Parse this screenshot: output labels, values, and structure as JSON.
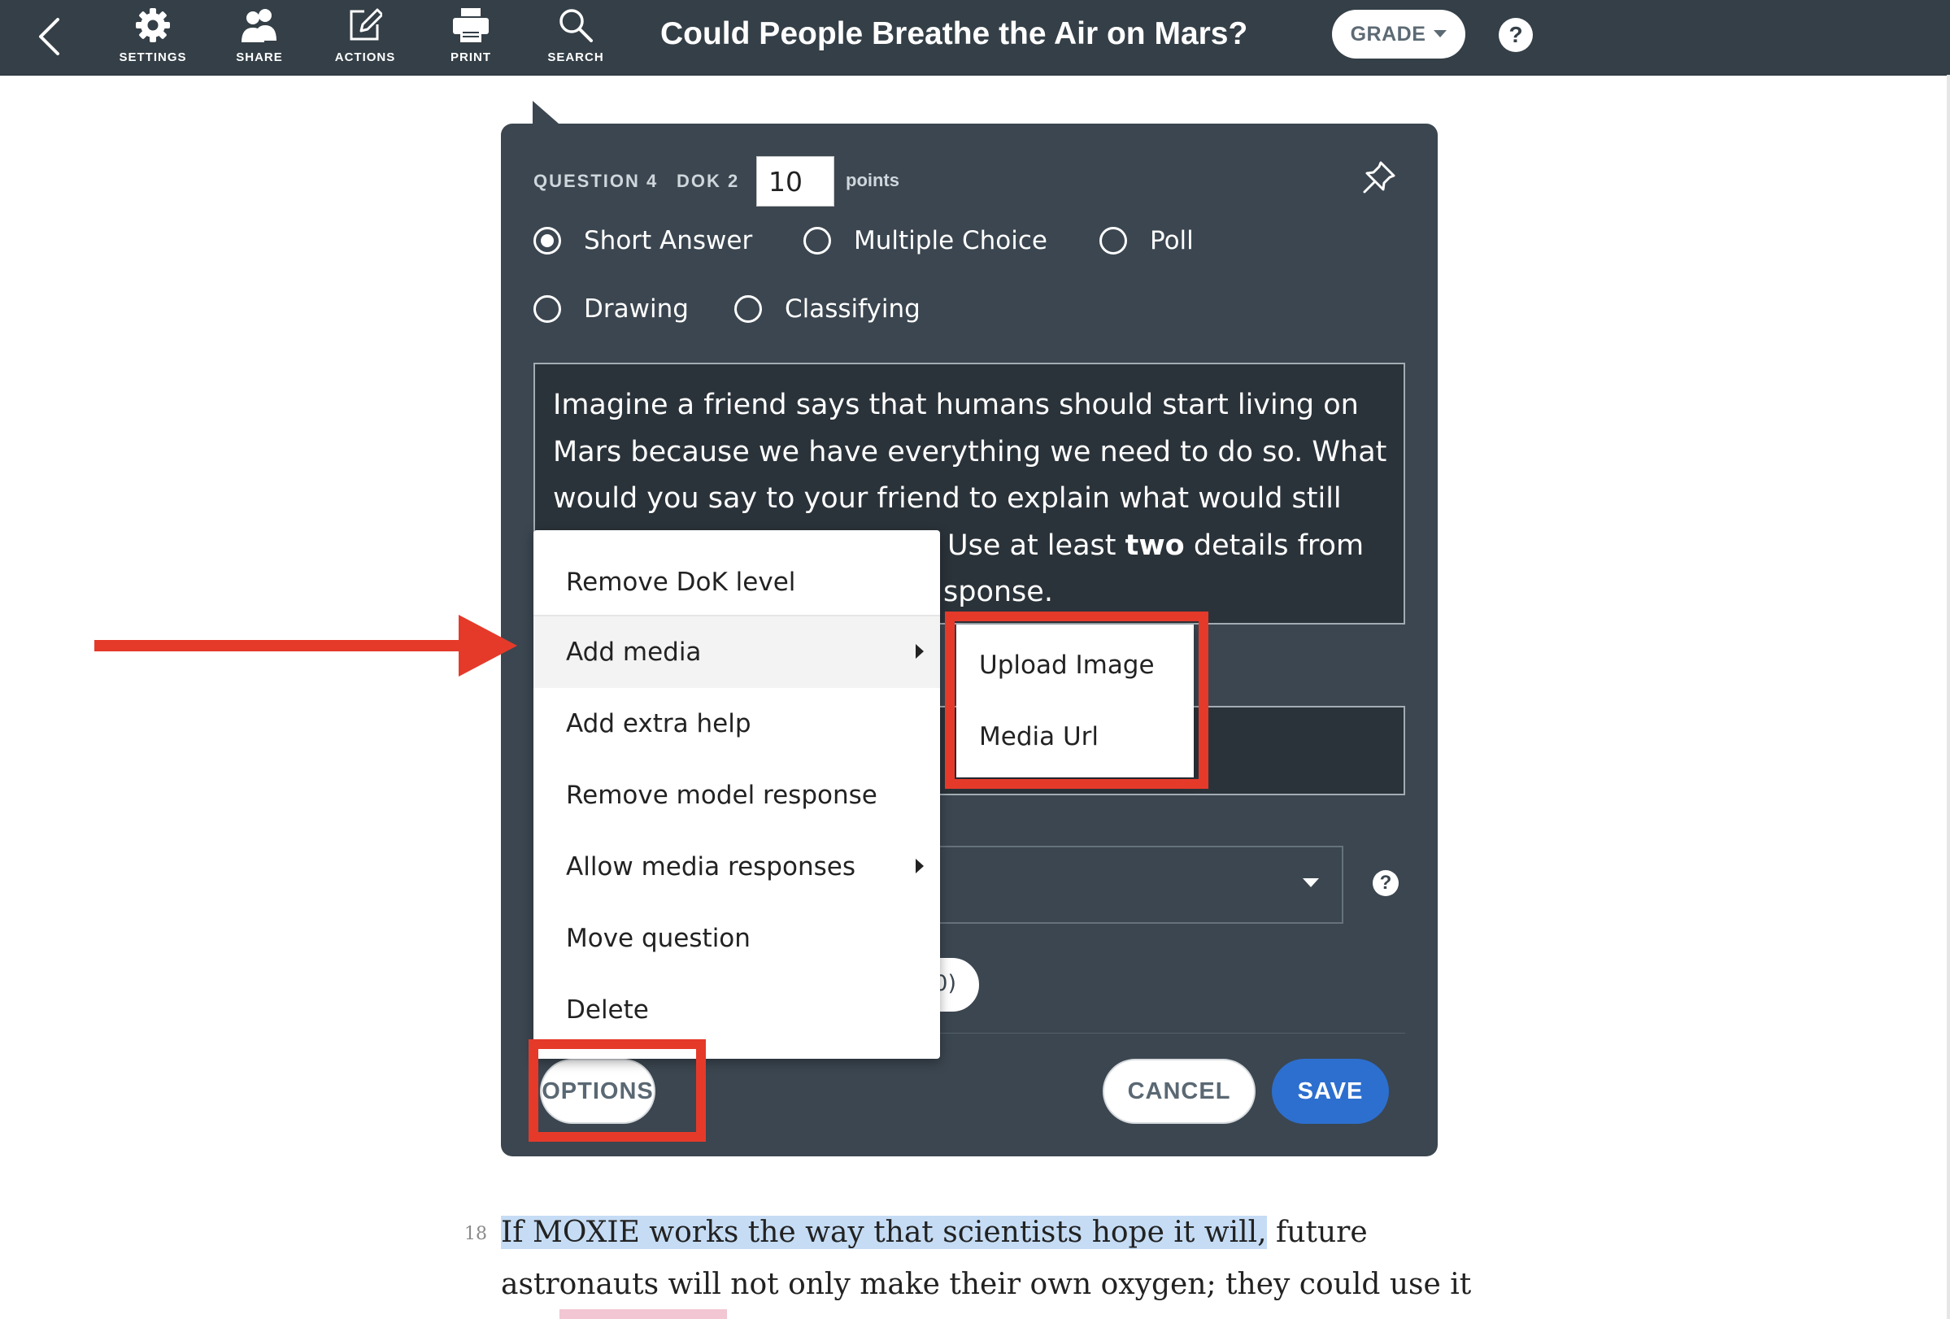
{
  "toolbar": {
    "tools": [
      {
        "label": "SETTINGS",
        "icon": "gear-icon"
      },
      {
        "label": "SHARE",
        "icon": "people-icon"
      },
      {
        "label": "ACTIONS",
        "icon": "edit-icon"
      },
      {
        "label": "PRINT",
        "icon": "printer-icon"
      },
      {
        "label": "SEARCH",
        "icon": "search-icon"
      }
    ],
    "title": "Could People Breathe the Air on Mars?",
    "grade_label": "GRADE",
    "help_symbol": "?"
  },
  "question": {
    "number_label": "QUESTION 4",
    "dok_label": "DOK 2",
    "points_value": "10",
    "points_label": "points",
    "types": [
      {
        "label": "Short Answer",
        "selected": true
      },
      {
        "label": "Multiple Choice",
        "selected": false
      },
      {
        "label": "Poll",
        "selected": false
      },
      {
        "label": "Drawing",
        "selected": false
      },
      {
        "label": "Classifying",
        "selected": false
      }
    ],
    "prompt": {
      "line1": "Imagine a friend says that humans should start living on",
      "line2": "Mars because we have everything we need to do so. What",
      "line3": "would you say to your friend to explain what would still",
      "line4_pre": "Use at least ",
      "line4_bold": "two",
      "line4_post": " details from",
      "line5": "sponse."
    },
    "chip_text": "0)",
    "help_symbol": "?"
  },
  "buttons": {
    "options": "OPTIONS",
    "cancel": "CANCEL",
    "save": "SAVE"
  },
  "options_menu": {
    "items": [
      "Remove DoK level",
      "Add media",
      "Add extra help",
      "Remove model response",
      "Allow media responses",
      "Move question",
      "Delete"
    ],
    "submenu": [
      "Upload Image",
      "Media Url"
    ]
  },
  "passage": {
    "line_number": "18",
    "line1_highlighted": "If MOXIE works the way that scientists hope it will,",
    "line1_rest": " future",
    "line2": "astronauts will not only make their own oxygen; they could use it"
  },
  "colors": {
    "toolbar_bg": "#343f47",
    "panel_bg": "#3b4650",
    "save_blue": "#2d6fcf",
    "annotation_red": "#e53a2a",
    "passage_highlight": "#c5dcf4"
  }
}
